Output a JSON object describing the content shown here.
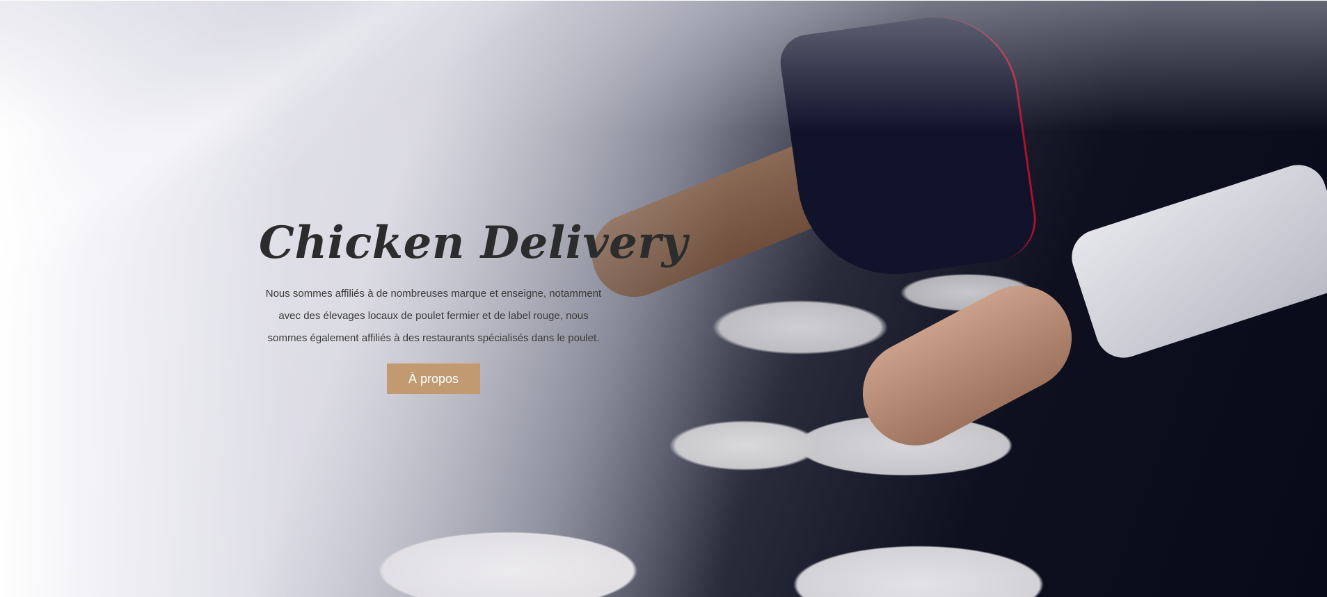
{
  "hero": {
    "title": "Chicken Delivery",
    "description": "Nous sommes affiliés à de nombreuses marque et enseigne, notamment avec des élevages locaux de poulet fermier et de label rouge, nous sommes également affiliés à des restaurants spécialisés dans le poulet.",
    "button_label": "À propos",
    "background_image": "chef-plating-dishes-photo"
  },
  "colors": {
    "button": "#c19a72",
    "title": "#2c2c2c",
    "text": "#3a3a3a"
  }
}
